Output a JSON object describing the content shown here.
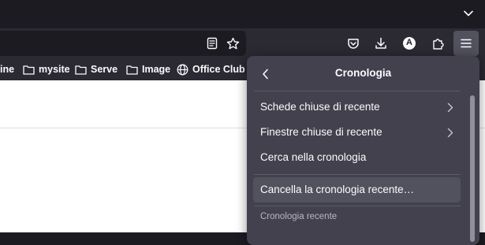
{
  "bookmarks": {
    "items": [
      {
        "label": "ine",
        "icon": "partial-icon"
      },
      {
        "label": "mysite",
        "icon": "folder-icon"
      },
      {
        "label": "Server",
        "icon": "folder-icon"
      },
      {
        "label": "Image",
        "icon": "folder-icon"
      },
      {
        "label": "Office Club",
        "icon": "globe-icon"
      }
    ]
  },
  "toolbar": {
    "account_initial": "A"
  },
  "history_panel": {
    "title": "Cronologia",
    "items": [
      {
        "label": "Schede chiuse di recente",
        "has_submenu": true
      },
      {
        "label": "Finestre chiuse di recente",
        "has_submenu": true
      },
      {
        "label": "Cerca nella cronologia",
        "has_submenu": false
      },
      {
        "label": "Cancella la cronologia recente…",
        "has_submenu": false
      }
    ],
    "section_label": "Cronologia recente"
  },
  "colors": {
    "panel_bg": "#42414d",
    "toolbar_bg": "#2b2a33",
    "titlebar_bg": "#1c1b22",
    "text": "#fbfbfe"
  }
}
